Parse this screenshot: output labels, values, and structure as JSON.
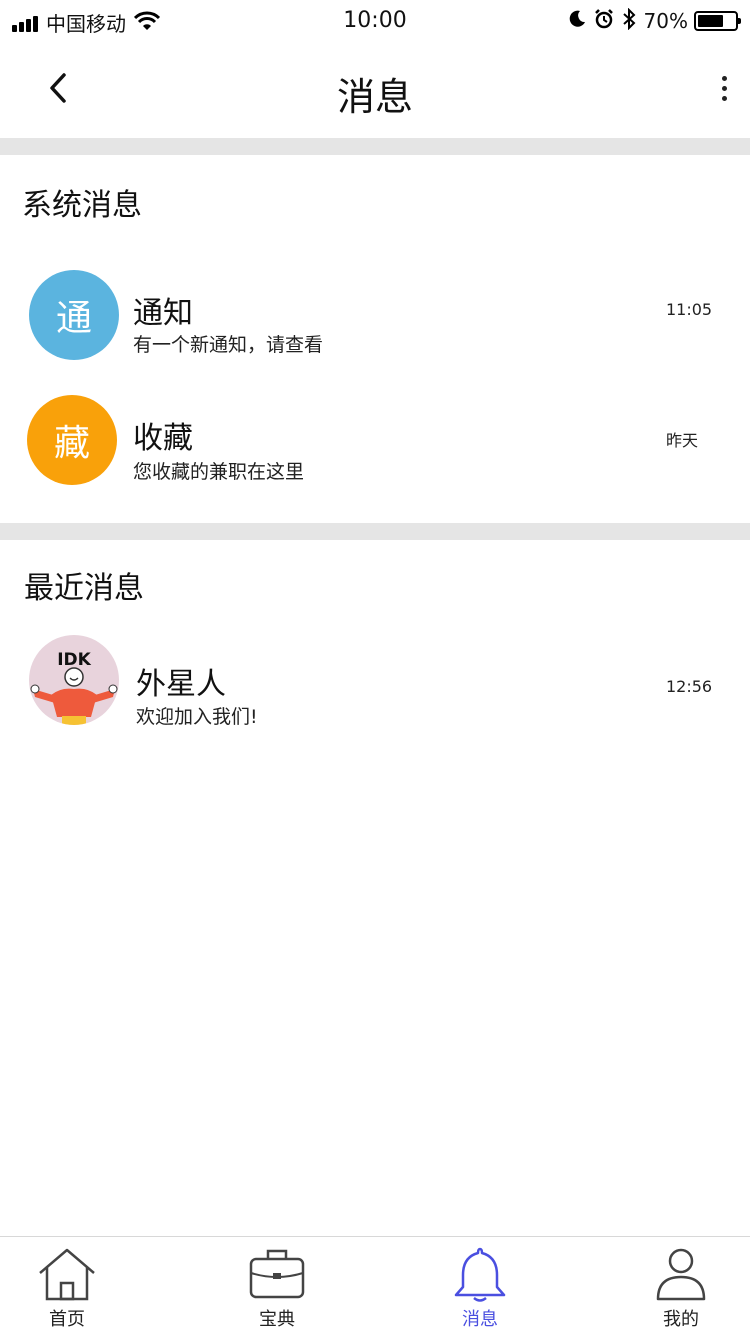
{
  "status_bar": {
    "carrier": "中国移动",
    "time": "10:00",
    "battery": "70%",
    "battery_level": 0.7
  },
  "nav": {
    "title": "消息"
  },
  "system_section": {
    "title": "系统消息",
    "items": [
      {
        "avatar_text": "通",
        "avatar_color": "#5bb4df",
        "name": "通知",
        "preview": "有一个新通知，请查看",
        "time": "11:05"
      },
      {
        "avatar_text": "藏",
        "avatar_color": "#f9a10a",
        "name": "收藏",
        "preview": "您收藏的兼职在这里",
        "time": "昨天"
      }
    ]
  },
  "recent_section": {
    "title": "最近消息",
    "items": [
      {
        "avatar_text": "IDK",
        "name": "外星人",
        "preview": "欢迎加入我们!",
        "time": "12:56"
      }
    ]
  },
  "tab_bar": {
    "active_color": "#4a4fe0",
    "tabs": [
      {
        "label": "首页",
        "icon": "home-icon"
      },
      {
        "label": "宝典",
        "icon": "briefcase-icon"
      },
      {
        "label": "消息",
        "icon": "bell-icon",
        "active": true
      },
      {
        "label": "我的",
        "icon": "person-icon"
      }
    ]
  }
}
